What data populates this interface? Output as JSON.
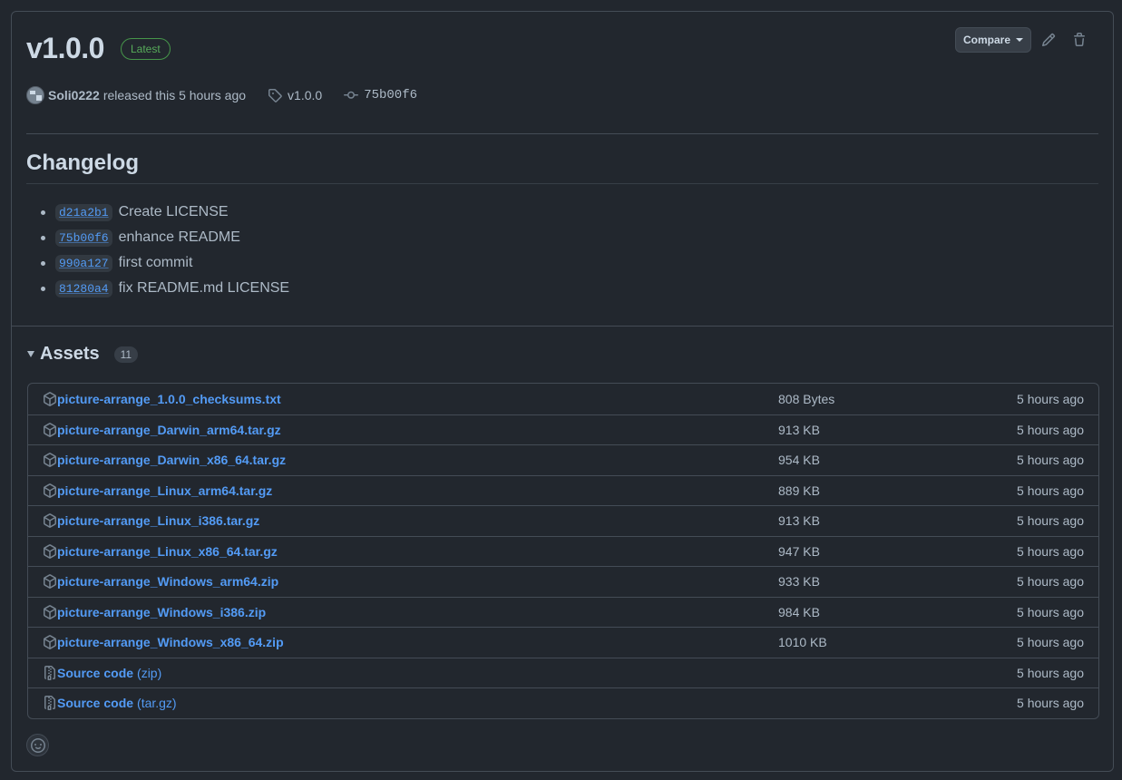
{
  "release": {
    "version": "v1.0.0",
    "badge": "Latest",
    "author": "Soli0222",
    "released_text": "released this 5 hours ago",
    "tag": "v1.0.0",
    "commit": "75b00f6"
  },
  "toolbar": {
    "compare_label": "Compare",
    "icons": [
      "pencil-icon",
      "trash-icon"
    ]
  },
  "changelog": {
    "title": "Changelog",
    "items": [
      {
        "sha": "d21a2b1",
        "message": "Create LICENSE"
      },
      {
        "sha": "75b00f6",
        "message": "enhance README"
      },
      {
        "sha": "990a127",
        "message": "first commit"
      },
      {
        "sha": "81280a4",
        "message": "fix README.md LICENSE"
      }
    ]
  },
  "assets": {
    "title": "Assets",
    "count": "11",
    "items": [
      {
        "name": "picture-arrange_1.0.0_checksums.txt",
        "suffix": "",
        "size": "808 Bytes",
        "time": "5 hours ago",
        "icon": "package-icon"
      },
      {
        "name": "picture-arrange_Darwin_arm64.tar.gz",
        "suffix": "",
        "size": "913 KB",
        "time": "5 hours ago",
        "icon": "package-icon"
      },
      {
        "name": "picture-arrange_Darwin_x86_64.tar.gz",
        "suffix": "",
        "size": "954 KB",
        "time": "5 hours ago",
        "icon": "package-icon"
      },
      {
        "name": "picture-arrange_Linux_arm64.tar.gz",
        "suffix": "",
        "size": "889 KB",
        "time": "5 hours ago",
        "icon": "package-icon"
      },
      {
        "name": "picture-arrange_Linux_i386.tar.gz",
        "suffix": "",
        "size": "913 KB",
        "time": "5 hours ago",
        "icon": "package-icon"
      },
      {
        "name": "picture-arrange_Linux_x86_64.tar.gz",
        "suffix": "",
        "size": "947 KB",
        "time": "5 hours ago",
        "icon": "package-icon"
      },
      {
        "name": "picture-arrange_Windows_arm64.zip",
        "suffix": "",
        "size": "933 KB",
        "time": "5 hours ago",
        "icon": "package-icon"
      },
      {
        "name": "picture-arrange_Windows_i386.zip",
        "suffix": "",
        "size": "984 KB",
        "time": "5 hours ago",
        "icon": "package-icon"
      },
      {
        "name": "picture-arrange_Windows_x86_64.zip",
        "suffix": "",
        "size": "1010 KB",
        "time": "5 hours ago",
        "icon": "package-icon"
      },
      {
        "name": "Source code",
        "suffix": "(zip)",
        "size": "",
        "time": "5 hours ago",
        "icon": "file-zip-icon"
      },
      {
        "name": "Source code",
        "suffix": "(tar.gz)",
        "size": "",
        "time": "5 hours ago",
        "icon": "file-zip-icon"
      }
    ]
  },
  "colors": {
    "background": "#22272e",
    "border": "#444c56",
    "link": "#539bf5",
    "badge_green": "#57ab5a",
    "text": "#adbac7",
    "heading": "#cdd9e5"
  }
}
